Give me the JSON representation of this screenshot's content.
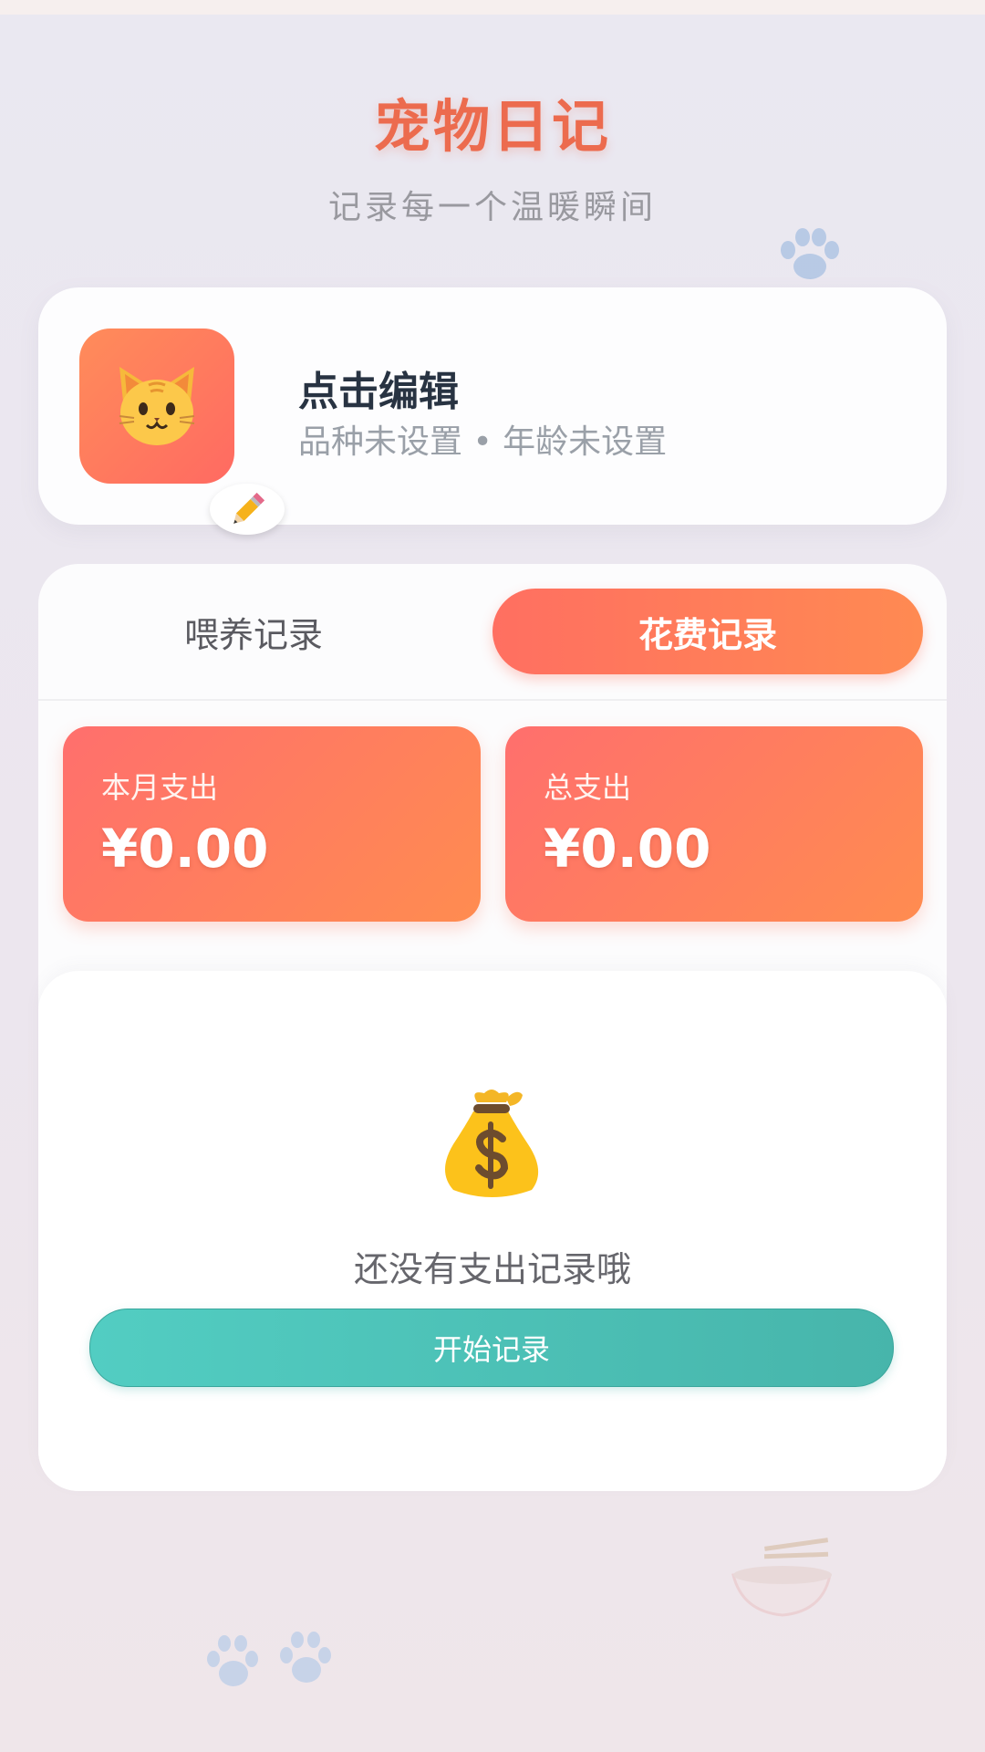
{
  "header": {
    "title": "宠物日记",
    "subtitle": "记录每一个温暖瞬间"
  },
  "profile": {
    "name": "点击编辑",
    "meta": "品种未设置 • 年龄未设置",
    "avatar_icon": "cat-face-icon",
    "edit_icon": "pencil-icon"
  },
  "tabs": [
    {
      "label": "喂养记录",
      "active": false
    },
    {
      "label": "花费记录",
      "active": true
    }
  ],
  "stats": {
    "month_label": "本月支出",
    "month_value": "¥0.00",
    "total_label": "总支出",
    "total_value": "¥0.00"
  },
  "empty_state": {
    "icon": "money-bag-icon",
    "message": "还没有支出记录哦",
    "button_label": "开始记录"
  },
  "colors": {
    "accent": "#ec6b4e",
    "tab_active_start": "#ff6f61",
    "tab_active_end": "#ff8a52",
    "button_teal": "#4ec4b9"
  }
}
